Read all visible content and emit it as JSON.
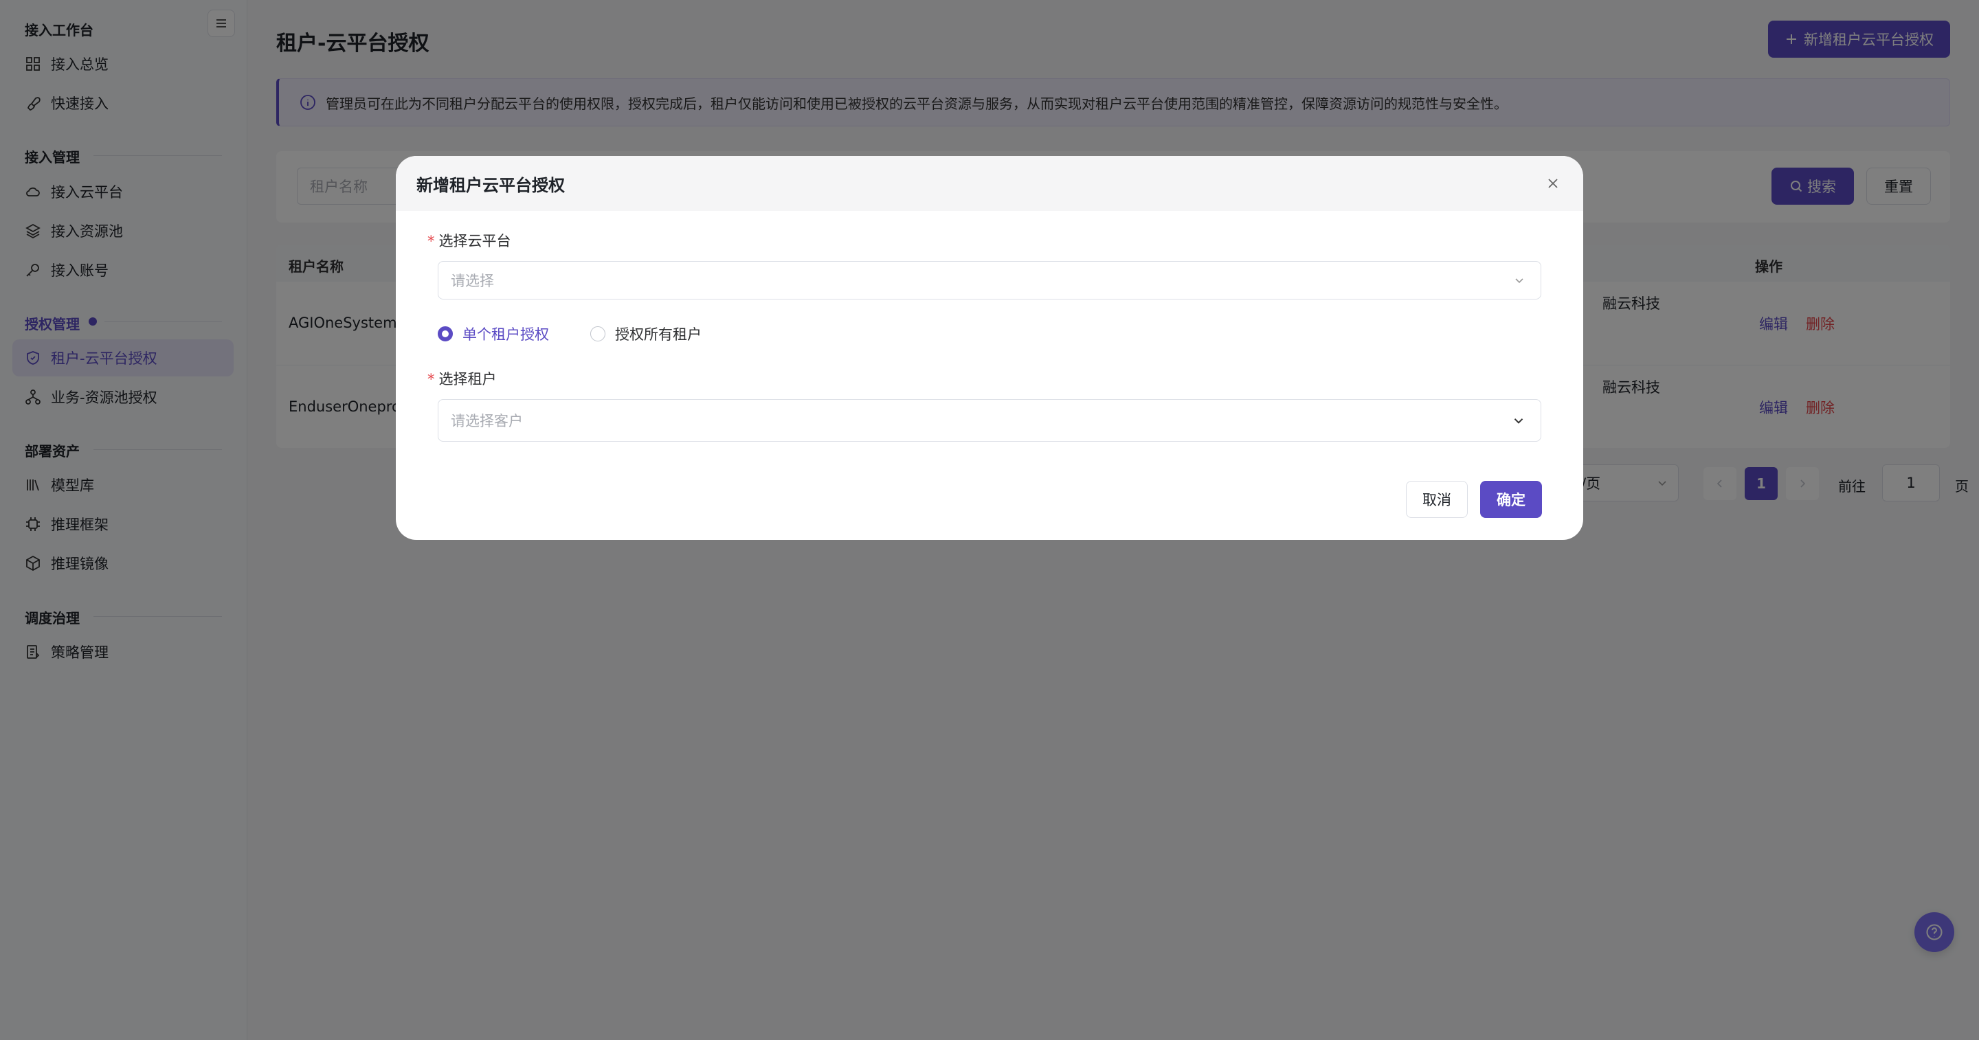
{
  "sidebar": {
    "groups": [
      {
        "title": "接入工作台",
        "items": [
          {
            "label": "接入总览",
            "icon": "grid-icon"
          },
          {
            "label": "快速接入",
            "icon": "rocket-icon"
          }
        ]
      },
      {
        "title": "接入管理",
        "items": [
          {
            "label": "接入云平台",
            "icon": "cloud-icon"
          },
          {
            "label": "接入资源池",
            "icon": "layers-icon"
          },
          {
            "label": "接入账号",
            "icon": "key-icon"
          }
        ]
      },
      {
        "title": "授权管理",
        "items": [
          {
            "label": "租户-云平台授权",
            "icon": "shield-icon",
            "active": true
          },
          {
            "label": "业务-资源池授权",
            "icon": "org-icon"
          }
        ]
      },
      {
        "title": "部署资产",
        "items": [
          {
            "label": "模型库",
            "icon": "library-icon"
          },
          {
            "label": "推理框架",
            "icon": "chip-icon"
          },
          {
            "label": "推理镜像",
            "icon": "cube-icon"
          }
        ]
      },
      {
        "title": "调度治理",
        "items": [
          {
            "label": "策略管理",
            "icon": "policy-icon"
          }
        ]
      }
    ]
  },
  "main": {
    "title": "租户-云平台授权",
    "add_button": "新增租户云平台授权",
    "notice": "管理员可在此为不同租户分配云平台的使用权限，授权完成后，租户仅能访问和使用已被授权的云平台资源与服务，从而实现对租户云平台使用范围的精准管控，保障资源访问的规范性与安全性。",
    "filter": {
      "placeholder": "租户名称",
      "search": "搜索",
      "reset": "重置"
    },
    "table": {
      "headers": {
        "name": "租户名称",
        "op": "操作"
      },
      "rows": [
        {
          "name": "AGIOneSystem",
          "cloud": "融云科技",
          "edit": "编辑",
          "delete": "删除"
        },
        {
          "name": "EnduserOnepro",
          "cloud": "融云科技",
          "edit": "编辑",
          "delete": "删除"
        }
      ]
    },
    "pager": {
      "size": "条/页",
      "current": "1",
      "goto": "前往",
      "goto_value": "1",
      "page_suffix": "页"
    }
  },
  "modal": {
    "title": "新增租户云平台授权",
    "cloud_label": "选择云平台",
    "cloud_placeholder": "请选择",
    "radio_single": "单个租户授权",
    "radio_all": "授权所有租户",
    "tenant_label": "选择租户",
    "tenant_placeholder": "请选择客户",
    "cancel": "取消",
    "confirm": "确定"
  },
  "colors": {
    "accent": "#5b4bc4",
    "danger": "#e5484d"
  }
}
